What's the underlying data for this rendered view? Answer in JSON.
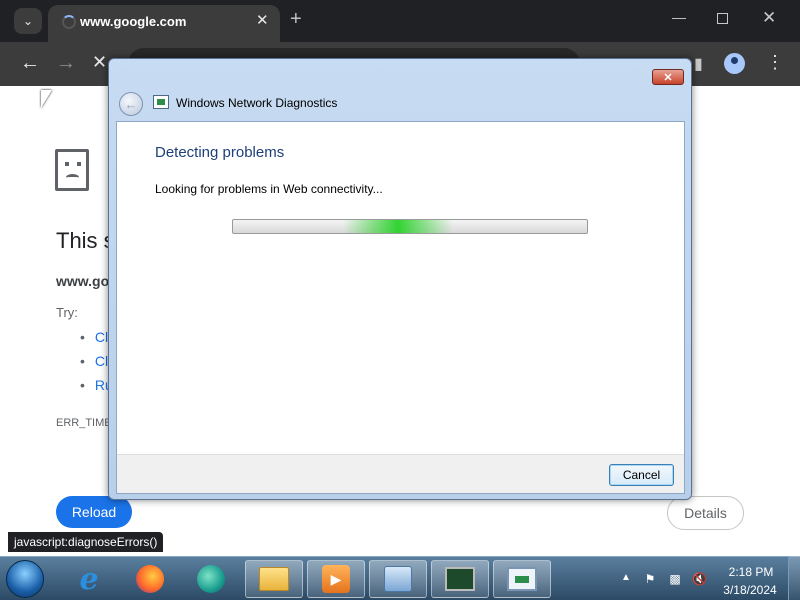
{
  "browser": {
    "tab_title": "www.google.com",
    "tab_list_icon": "chevron-down-icon",
    "new_tab_label": "+",
    "status_url": "javascript:diagnoseErrors()"
  },
  "page": {
    "heading": "This s",
    "domain": "www.goog",
    "try_label": "Try:",
    "suggestions": [
      "Cl",
      "Cl",
      "Ru"
    ],
    "error_code": "ERR_TIME",
    "reload_label": "Reload",
    "details_label": "Details"
  },
  "dialog": {
    "title": "Windows Network Diagnostics",
    "heading": "Detecting problems",
    "status": "Looking for problems in Web connectivity...",
    "cancel_label": "Cancel",
    "progress_fraction": 0.45,
    "colors": {
      "heading": "#1e3f7a",
      "progress_glow": "#28d228"
    }
  },
  "taskbar": {
    "apps": [
      "ie-icon",
      "firefox-icon",
      "edge-icon",
      "file-explorer-icon",
      "media-player-icon",
      "control-panel-icon",
      "performance-monitor-icon",
      "network-diagnostics-icon"
    ],
    "time": "2:18 PM",
    "date": "3/18/2024"
  }
}
